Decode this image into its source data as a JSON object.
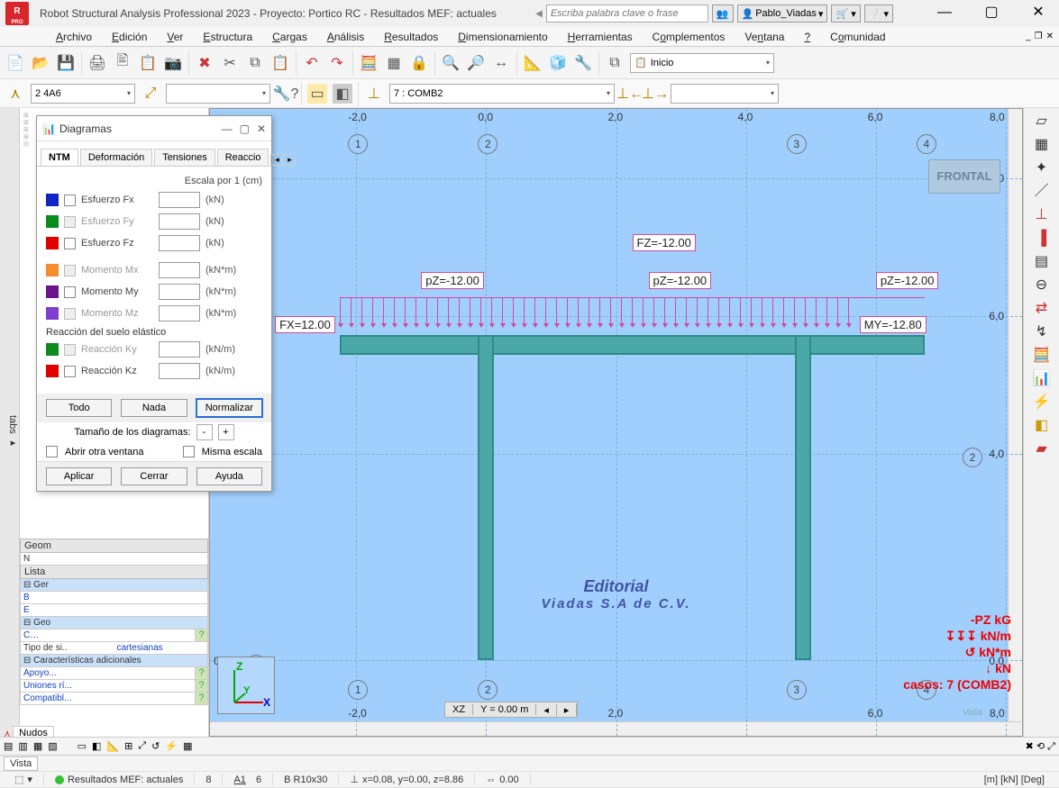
{
  "title": "Robot Structural Analysis Professional 2023 - Proyecto: Portico RC - Resultados MEF: actuales",
  "search_placeholder": "Escriba palabra clave o frase",
  "user": "Pablo_Viadas",
  "menus": [
    "Archivo",
    "Edición",
    "Ver",
    "Estructura",
    "Cargas",
    "Análisis",
    "Resultados",
    "Dimensionamiento",
    "Herramientas",
    "Complementos",
    "Ventana",
    "?",
    "Comunidad"
  ],
  "combo_layout": "Inicio",
  "combo_selection": "2 4A6",
  "combo_case": "7 : COMB2",
  "dlg": {
    "title": "Diagramas",
    "tabs": [
      "NTM",
      "Deformación",
      "Tensiones",
      "Reaccio"
    ],
    "active_tab": "NTM",
    "scale_label": "Escala por 1  (cm)",
    "rows": [
      {
        "label": "Esfuerzo Fx",
        "unit": "(kN)",
        "color": "#1026c0",
        "enabled": true
      },
      {
        "label": "Esfuerzo Fy",
        "unit": "(kN)",
        "color": "#0a8a1f",
        "enabled": false
      },
      {
        "label": "Esfuerzo Fz",
        "unit": "(kN)",
        "color": "#e00000",
        "enabled": true
      },
      {
        "label": "Momento Mx",
        "unit": "(kN*m)",
        "color": "#f58c2e",
        "enabled": false
      },
      {
        "label": "Momento My",
        "unit": "(kN*m)",
        "color": "#6a1589",
        "enabled": false
      },
      {
        "label": "Momento Mz",
        "unit": "(kN*m)",
        "color": "#7e3ed1",
        "enabled": false
      }
    ],
    "react_label": "Reacción del suelo elástico",
    "react_rows": [
      {
        "label": "Reacción Ky",
        "unit": "(kN/m)",
        "color": "#0a8a1f",
        "enabled": false
      },
      {
        "label": "Reacción Kz",
        "unit": "(kN/m)",
        "color": "#e00000",
        "enabled": true
      }
    ],
    "btns": {
      "all": "Todo",
      "none": "Nada",
      "normalize": "Normalizar",
      "apply": "Aplicar",
      "close": "Cerrar",
      "help": "Ayuda"
    },
    "sizer_label": "Tamaño de los diagramas:",
    "chk_open_win": "Abrir otra ventana",
    "chk_same_scale": "Misma escala"
  },
  "canvas": {
    "ticks_x": [
      "-2,0",
      "0,0",
      "2,0",
      "4,0",
      "6,0",
      "8,0"
    ],
    "ticks_y": [
      "8,0",
      "6,0",
      "4,0",
      "0,0"
    ],
    "grid_cols": [
      "1",
      "2",
      "3",
      "4"
    ],
    "grid_rows": [
      "1",
      "2"
    ],
    "frontal": "FRONTAL",
    "labels": {
      "fx": "FX=12.00",
      "fz": "FZ=-12.00",
      "pz1": "pZ=-12.00",
      "pz2": "pZ=-12.00",
      "pz3": "pZ=-12.00",
      "my": "MY=-12.80"
    },
    "legend": [
      "-PZ  kG",
      "kN/m",
      "kN*m",
      "kN",
      "casos: 7 (COMB2)"
    ],
    "xz_bar": {
      "plane": "XZ",
      "coord": "Y = 0.00 m"
    },
    "watermark": [
      "Editorial",
      "Viadas S.A de C.V."
    ],
    "vista": "Vista"
  },
  "props": {
    "hdr_geom": "Geom",
    "hdr_lista": "Lista",
    "sec_geo1": "Ger",
    "sec_geo2": "Geo",
    "tipo_row": {
      "k": "Tipo de si..",
      "v": "cartesianas"
    },
    "sec_caract": "Características adicionales",
    "rows": [
      {
        "k": "Apoyo..."
      },
      {
        "k": "Uniones rí..."
      },
      {
        "k": "Compatibl..."
      }
    ],
    "nudos_tab": "Nudos"
  },
  "status": {
    "tab_vista": "Vista",
    "mef": "Resultados MEF: actuales",
    "n1": "8",
    "n2_pref": "A1",
    "n2": "6",
    "section": "B R10x30",
    "coords": "x=0.08, y=0.00, z=8.86",
    "d": "0.00",
    "units": "[m] [kN] [Deg]"
  },
  "tabs_left": "tabs"
}
